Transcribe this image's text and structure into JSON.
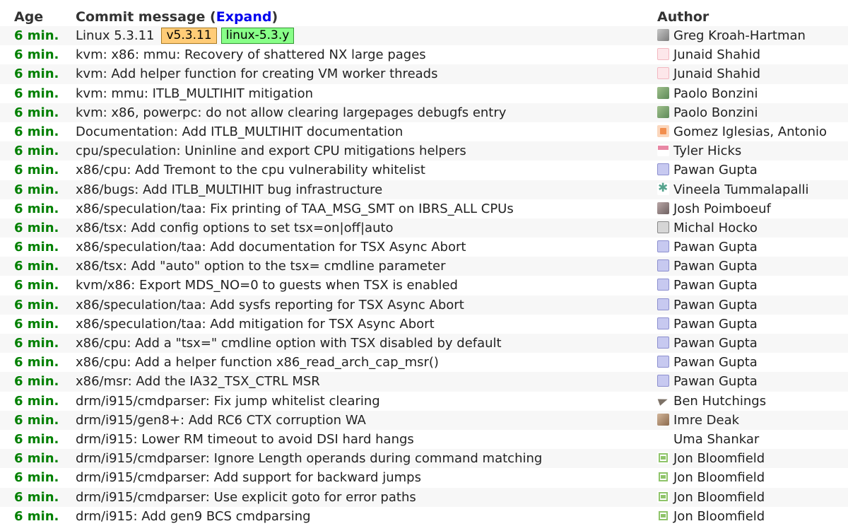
{
  "header": {
    "age_label": "Age",
    "message_label": "Commit message (",
    "expand_label": "Expand",
    "message_close": ")",
    "author_label": "Author"
  },
  "commits": [
    {
      "age": "6 min.",
      "message": "Linux 5.3.11",
      "tag": "v5.3.11",
      "branch": "linux-5.3.y",
      "author": "Greg Kroah-Hartman",
      "avatar": "photo"
    },
    {
      "age": "6 min.",
      "message": "kvm: x86: mmu: Recovery of shattered NX large pages",
      "author": "Junaid Shahid",
      "avatar": "pink"
    },
    {
      "age": "6 min.",
      "message": "kvm: Add helper function for creating VM worker threads",
      "author": "Junaid Shahid",
      "avatar": "pink"
    },
    {
      "age": "6 min.",
      "message": "kvm: mmu: ITLB_MULTIHIT mitigation",
      "author": "Paolo Bonzini",
      "avatar": "green"
    },
    {
      "age": "6 min.",
      "message": "kvm: x86, powerpc: do not allow clearing largepages debugfs entry",
      "author": "Paolo Bonzini",
      "avatar": "green"
    },
    {
      "age": "6 min.",
      "message": "Documentation: Add ITLB_MULTIHIT documentation",
      "author": "Gomez Iglesias, Antonio",
      "avatar": "orange"
    },
    {
      "age": "6 min.",
      "message": "cpu/speculation: Uninline and export CPU mitigations helpers",
      "author": "Tyler Hicks",
      "avatar": "pinkbar"
    },
    {
      "age": "6 min.",
      "message": "x86/cpu: Add Tremont to the cpu vulnerability whitelist",
      "author": "Pawan Gupta",
      "avatar": "lavender"
    },
    {
      "age": "6 min.",
      "message": "x86/bugs: Add ITLB_MULTIHIT bug infrastructure",
      "author": "Vineela Tummalapalli",
      "avatar": "teal"
    },
    {
      "age": "6 min.",
      "message": "x86/speculation/taa: Fix printing of TAA_MSG_SMT on IBRS_ALL CPUs",
      "author": "Josh Poimboeuf",
      "avatar": "gray"
    },
    {
      "age": "6 min.",
      "message": "x86/tsx: Add config options to set tsx=on|off|auto",
      "author": "Michal Hocko",
      "avatar": "mono"
    },
    {
      "age": "6 min.",
      "message": "x86/speculation/taa: Add documentation for TSX Async Abort",
      "author": "Pawan Gupta",
      "avatar": "lavender"
    },
    {
      "age": "6 min.",
      "message": "x86/tsx: Add \"auto\" option to the tsx= cmdline parameter",
      "author": "Pawan Gupta",
      "avatar": "lavender"
    },
    {
      "age": "6 min.",
      "message": "kvm/x86: Export MDS_NO=0 to guests when TSX is enabled",
      "author": "Pawan Gupta",
      "avatar": "lavender"
    },
    {
      "age": "6 min.",
      "message": "x86/speculation/taa: Add sysfs reporting for TSX Async Abort",
      "author": "Pawan Gupta",
      "avatar": "lavender"
    },
    {
      "age": "6 min.",
      "message": "x86/speculation/taa: Add mitigation for TSX Async Abort",
      "author": "Pawan Gupta",
      "avatar": "lavender"
    },
    {
      "age": "6 min.",
      "message": "x86/cpu: Add a \"tsx=\" cmdline option with TSX disabled by default",
      "author": "Pawan Gupta",
      "avatar": "lavender"
    },
    {
      "age": "6 min.",
      "message": "x86/cpu: Add a helper function x86_read_arch_cap_msr()",
      "author": "Pawan Gupta",
      "avatar": "lavender"
    },
    {
      "age": "6 min.",
      "message": "x86/msr: Add the IA32_TSX_CTRL MSR",
      "author": "Pawan Gupta",
      "avatar": "lavender"
    },
    {
      "age": "6 min.",
      "message": "drm/i915/cmdparser: Fix jump whitelist clearing",
      "author": "Ben Hutchings",
      "avatar": "bird"
    },
    {
      "age": "6 min.",
      "message": "drm/i915/gen8+: Add RC6 CTX corruption WA",
      "author": "Imre Deak",
      "avatar": "brown"
    },
    {
      "age": "6 min.",
      "message": "drm/i915: Lower RM timeout to avoid DSI hard hangs",
      "author": "Uma Shankar",
      "avatar": "blank"
    },
    {
      "age": "6 min.",
      "message": "drm/i915/cmdparser: Ignore Length operands during command matching",
      "author": "Jon Bloomfield",
      "avatar": "lime"
    },
    {
      "age": "6 min.",
      "message": "drm/i915/cmdparser: Add support for backward jumps",
      "author": "Jon Bloomfield",
      "avatar": "lime"
    },
    {
      "age": "6 min.",
      "message": "drm/i915/cmdparser: Use explicit goto for error paths",
      "author": "Jon Bloomfield",
      "avatar": "lime"
    },
    {
      "age": "6 min.",
      "message": "drm/i915: Add gen9 BCS cmdparsing",
      "author": "Jon Bloomfield",
      "avatar": "lime"
    }
  ]
}
